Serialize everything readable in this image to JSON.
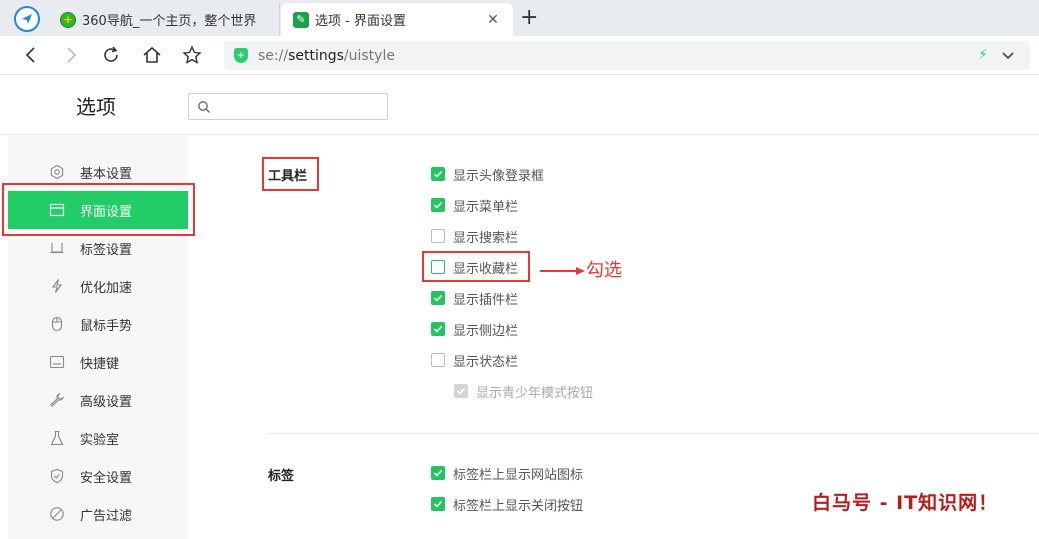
{
  "tabs": [
    {
      "title": "360导航_一个主页，整个世界",
      "active": false
    },
    {
      "title": "选项 - 界面设置",
      "active": true
    }
  ],
  "address": {
    "scheme": "se://",
    "host": "settings",
    "path": "/uistyle"
  },
  "icons": {
    "back": "back-icon",
    "forward": "forward-icon",
    "reload": "reload-icon",
    "home": "home-icon",
    "star": "star-icon",
    "bolt": "bolt-icon"
  },
  "page": {
    "title": "选项",
    "search_placeholder": ""
  },
  "sidebar": {
    "items": [
      {
        "label": "基本设置",
        "icon": "gear-icon"
      },
      {
        "label": "界面设置",
        "icon": "window-icon",
        "active": true
      },
      {
        "label": "标签设置",
        "icon": "tab-icon"
      },
      {
        "label": "优化加速",
        "icon": "bolt-icon"
      },
      {
        "label": "鼠标手势",
        "icon": "mouse-icon"
      },
      {
        "label": "快捷键",
        "icon": "keyboard-icon"
      },
      {
        "label": "高级设置",
        "icon": "wrench-icon"
      },
      {
        "label": "实验室",
        "icon": "flask-icon"
      },
      {
        "label": "安全设置",
        "icon": "shield-icon"
      },
      {
        "label": "广告过滤",
        "icon": "block-icon"
      }
    ]
  },
  "toolbar_section": {
    "title": "工具栏",
    "options": [
      {
        "label": "显示头像登录框",
        "checked": true
      },
      {
        "label": "显示菜单栏",
        "checked": true
      },
      {
        "label": "显示搜索栏",
        "checked": false
      },
      {
        "label": "显示收藏栏",
        "checked": false
      },
      {
        "label": "显示插件栏",
        "checked": true
      },
      {
        "label": "显示侧边栏",
        "checked": true
      },
      {
        "label": "显示状态栏",
        "checked": false
      },
      {
        "label": "显示青少年模式按钮",
        "checked": true,
        "disabled": true
      }
    ]
  },
  "tabs_section": {
    "title": "标签",
    "options": [
      {
        "label": "标签栏上显示网站图标",
        "checked": true
      },
      {
        "label": "标签栏上显示关闭按钮",
        "checked": true
      }
    ]
  },
  "annotation": {
    "text": "勾选"
  },
  "watermark": {
    "text": "白马号 - IT知识网！"
  },
  "colors": {
    "accent": "#22cc66",
    "checkbox": "#22c55e",
    "highlight": "#e53935"
  }
}
